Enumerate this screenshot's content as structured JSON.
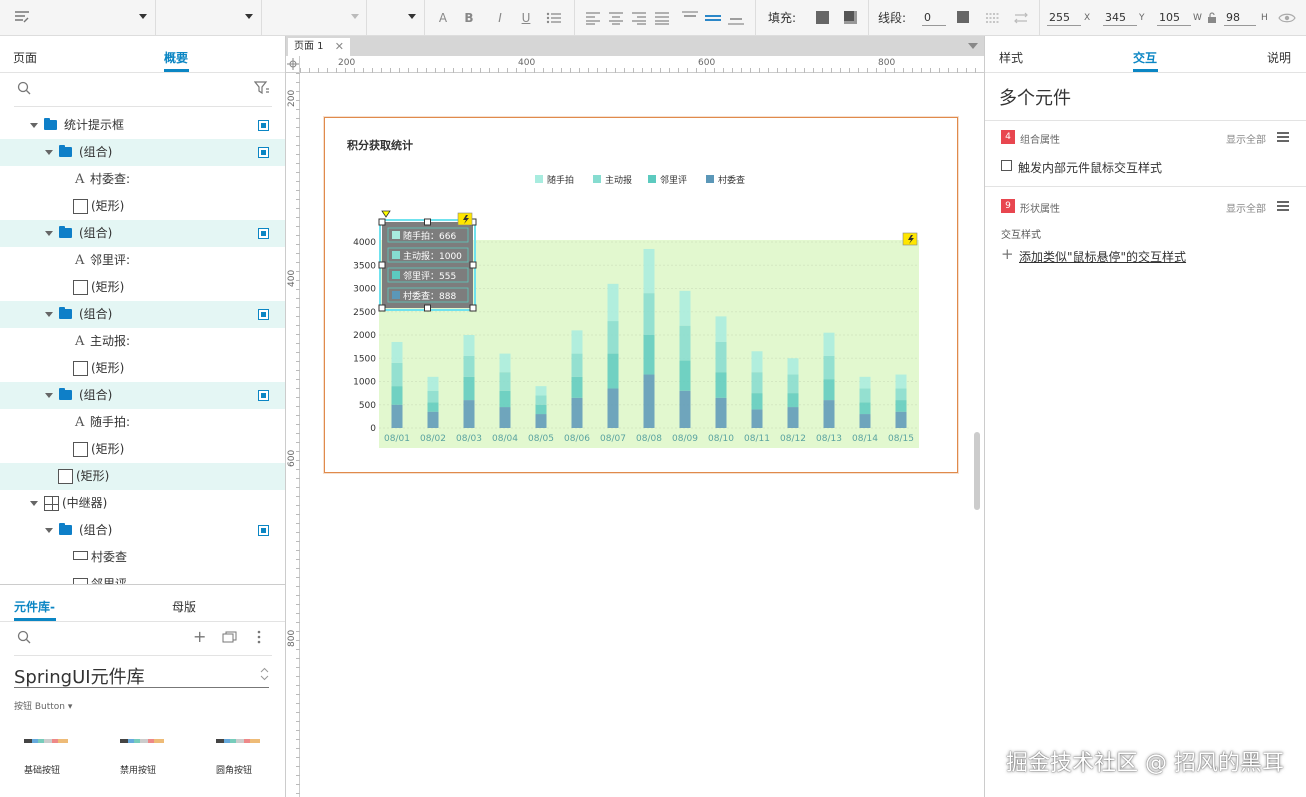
{
  "toolbar": {
    "fill_label": "填充:",
    "stroke_label": "线段:",
    "stroke_value": "0",
    "x_value": "255",
    "x_caption": "X",
    "y_value": "345",
    "y_caption": "Y",
    "w_value": "105",
    "w_caption": "W",
    "h_value": "98",
    "h_caption": "H",
    "icons": [
      "text-style-icon",
      "font-color-icon",
      "bold-icon",
      "italic-icon",
      "underline-icon",
      "list-icon",
      "align-left-icon",
      "align-center-icon",
      "align-right-icon",
      "justify-icon",
      "valign-top-icon",
      "valign-middle-icon",
      "valign-bottom-icon",
      "fill-color-icon",
      "shadow-icon",
      "stroke-color-icon",
      "stroke-pattern-icon",
      "arrow-style-icon",
      "lock-icon",
      "visibility-icon"
    ]
  },
  "left": {
    "tabs": [
      "页面",
      "概要"
    ],
    "active_tab": "概要",
    "tree": [
      {
        "label": "统计提示框",
        "kind": "folder",
        "level": 0,
        "hl": false
      },
      {
        "label": "(组合)",
        "kind": "folder",
        "level": 1,
        "hl": true
      },
      {
        "label": "村委查:",
        "kind": "text",
        "level": 2,
        "hl": false
      },
      {
        "label": "(矩形)",
        "kind": "rect",
        "level": 2,
        "hl": false
      },
      {
        "label": "(组合)",
        "kind": "folder",
        "level": 1,
        "hl": true
      },
      {
        "label": "邻里评:",
        "kind": "text",
        "level": 2,
        "hl": false
      },
      {
        "label": "(矩形)",
        "kind": "rect",
        "level": 2,
        "hl": false
      },
      {
        "label": "(组合)",
        "kind": "folder",
        "level": 1,
        "hl": true
      },
      {
        "label": "主动报:",
        "kind": "text",
        "level": 2,
        "hl": false
      },
      {
        "label": "(矩形)",
        "kind": "rect",
        "level": 2,
        "hl": false
      },
      {
        "label": "(组合)",
        "kind": "folder",
        "level": 1,
        "hl": true
      },
      {
        "label": "随手拍:",
        "kind": "text",
        "level": 2,
        "hl": false
      },
      {
        "label": "(矩形)",
        "kind": "rect",
        "level": 2,
        "hl": false
      },
      {
        "label": "(矩形)",
        "kind": "rect",
        "level": 1,
        "hl": true
      },
      {
        "label": "(中继器)",
        "kind": "repeater",
        "level": 0,
        "hl": false
      },
      {
        "label": "(组合)",
        "kind": "folder",
        "level": 1,
        "hl": false
      },
      {
        "label": "村委查",
        "kind": "hotspot",
        "level": 2,
        "hl": false
      },
      {
        "label": "邻里评",
        "kind": "hotspot",
        "level": 2,
        "hl": false
      }
    ],
    "lib_tabs": [
      "元件库-",
      "母版"
    ],
    "lib_name": "SpringUI元件库",
    "lib_category": "按钮 Button ▾",
    "lib_items": [
      "基础按钮",
      "禁用按钮",
      "圆角按钮"
    ]
  },
  "canvas": {
    "page_tab": "页面 1",
    "ruler_top": [
      "200",
      "400",
      "600",
      "800"
    ],
    "ruler_left": [
      "200",
      "400",
      "600",
      "800"
    ]
  },
  "right": {
    "tabs": [
      "样式",
      "交互",
      "说明"
    ],
    "active_tab": "交互",
    "title": "多个元件",
    "group_badge": "4",
    "group_label": "组合属性",
    "show_all_1": "显示全部",
    "trigger_label": "触发内部元件鼠标交互样式",
    "shape_badge": "9",
    "shape_label": "形状属性",
    "show_all_2": "显示全部",
    "interaction_style": "交互样式",
    "add_hover": "添加类似\"鼠标悬停\"的交互样式"
  },
  "watermark": "掘金技术社区 @ 招风的黑耳",
  "chart_data": {
    "type": "bar",
    "title": "积分获取统计",
    "categories": [
      "08/01",
      "08/02",
      "08/03",
      "08/04",
      "08/05",
      "08/06",
      "08/07",
      "08/08",
      "08/09",
      "08/10",
      "08/11",
      "08/12",
      "08/13",
      "08/14",
      "08/15"
    ],
    "series": [
      {
        "name": "随手拍",
        "color": "#a8ecdf",
        "values": [
          450,
          300,
          450,
          400,
          200,
          500,
          800,
          950,
          750,
          550,
          450,
          350,
          500,
          250,
          300
        ]
      },
      {
        "name": "主动报",
        "color": "#86dcd0",
        "values": [
          500,
          250,
          450,
          400,
          200,
          500,
          700,
          900,
          750,
          650,
          450,
          400,
          500,
          300,
          250
        ]
      },
      {
        "name": "邻里评",
        "color": "#5ccabf",
        "values": [
          400,
          200,
          500,
          350,
          200,
          450,
          750,
          850,
          650,
          550,
          350,
          300,
          450,
          250,
          250
        ]
      },
      {
        "name": "村委查",
        "color": "#5b97b8",
        "values": [
          500,
          350,
          600,
          450,
          300,
          650,
          850,
          1150,
          800,
          650,
          400,
          450,
          600,
          300,
          350
        ]
      }
    ],
    "yticks": [
      "0",
      "500",
      "1000",
      "1500",
      "2000",
      "2500",
      "3000",
      "3500",
      "4000"
    ],
    "ylim": [
      0,
      4000
    ],
    "tooltip": [
      {
        "label": "随手拍：666",
        "color": "#a8ecdf"
      },
      {
        "label": "主动报：1000",
        "color": "#86dcd0"
      },
      {
        "label": "邻里评：555",
        "color": "#5ccabf"
      },
      {
        "label": "村委查：888",
        "color": "#5b97b8"
      }
    ]
  }
}
